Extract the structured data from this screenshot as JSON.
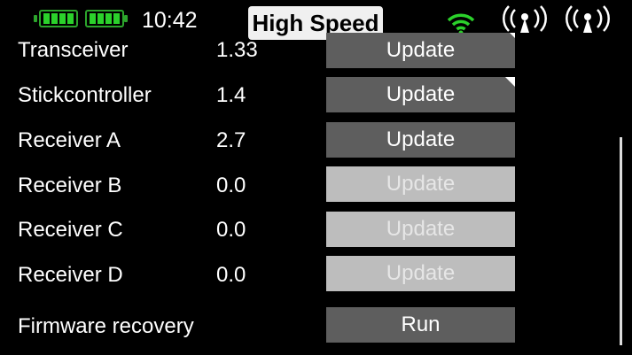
{
  "status_bar": {
    "time": "10:42",
    "mode": "High Speed",
    "icons": {
      "tx_battery": "battery-full-icon",
      "rx_battery": "battery-full-icon",
      "signal": "wifi-signal-icon",
      "antenna_1": "antenna-icon",
      "antenna_2": "antenna-icon"
    },
    "colors": {
      "battery": "#2bd12b",
      "signal": "#2bd12b",
      "badge_bg": "#f0f0f0"
    }
  },
  "rows": [
    {
      "label": "Transceiver",
      "version": "1.33",
      "action": "Update",
      "enabled": true
    },
    {
      "label": "Stickcontroller",
      "version": "1.4",
      "action": "Update",
      "enabled": true
    },
    {
      "label": "Receiver A",
      "version": "2.7",
      "action": "Update",
      "enabled": true
    },
    {
      "label": "Receiver B",
      "version": "0.0",
      "action": "Update",
      "enabled": false
    },
    {
      "label": "Receiver C",
      "version": "0.0",
      "action": "Update",
      "enabled": false
    },
    {
      "label": "Receiver D",
      "version": "0.0",
      "action": "Update",
      "enabled": false
    }
  ],
  "recovery": {
    "label": "Firmware recovery",
    "action": "Run"
  },
  "colors": {
    "button_active": "#5e5e5e",
    "button_disabled": "#bdbdbd",
    "background": "#000000"
  }
}
